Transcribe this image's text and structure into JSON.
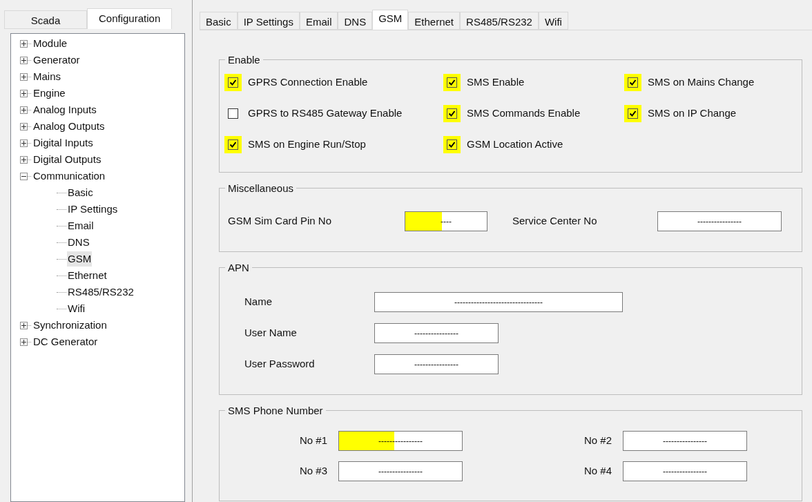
{
  "left_tabs": [
    {
      "label": "Scada",
      "selected": false
    },
    {
      "label": "Configuration",
      "selected": true
    }
  ],
  "tree": [
    {
      "label": "Module",
      "expanded": false,
      "selected": false
    },
    {
      "label": "Generator",
      "expanded": false,
      "selected": false
    },
    {
      "label": "Mains",
      "expanded": false,
      "selected": false
    },
    {
      "label": "Engine",
      "expanded": false,
      "selected": false
    },
    {
      "label": "Analog Inputs",
      "expanded": false,
      "selected": false
    },
    {
      "label": "Analog Outputs",
      "expanded": false,
      "selected": false
    },
    {
      "label": "Digital Inputs",
      "expanded": false,
      "selected": false
    },
    {
      "label": "Digital Outputs",
      "expanded": false,
      "selected": false
    },
    {
      "label": "Communication",
      "expanded": true,
      "selected": false,
      "children": [
        {
          "label": "Basic",
          "selected": false
        },
        {
          "label": "IP Settings",
          "selected": false
        },
        {
          "label": "Email",
          "selected": false
        },
        {
          "label": "DNS",
          "selected": false
        },
        {
          "label": "GSM",
          "selected": true
        },
        {
          "label": "Ethernet",
          "selected": false
        },
        {
          "label": "RS485/RS232",
          "selected": false
        },
        {
          "label": "Wifi",
          "selected": false
        }
      ]
    },
    {
      "label": "Synchronization",
      "expanded": false,
      "selected": false
    },
    {
      "label": "DC Generator",
      "expanded": false,
      "selected": false
    }
  ],
  "tabs": [
    {
      "label": "Basic",
      "selected": false
    },
    {
      "label": "IP Settings",
      "selected": false
    },
    {
      "label": "Email",
      "selected": false
    },
    {
      "label": "DNS",
      "selected": false
    },
    {
      "label": "GSM",
      "selected": true
    },
    {
      "label": "Ethernet",
      "selected": false
    },
    {
      "label": "RS485/RS232",
      "selected": false
    },
    {
      "label": "Wifi",
      "selected": false
    }
  ],
  "enable": {
    "title": "Enable",
    "options": [
      {
        "label": "GPRS Connection Enable",
        "checked": true,
        "highlighted": true
      },
      {
        "label": "SMS Enable",
        "checked": true,
        "highlighted": true
      },
      {
        "label": "SMS on Mains Change",
        "checked": true,
        "highlighted": true
      },
      {
        "label": "GPRS to RS485 Gateway Enable",
        "checked": false,
        "highlighted": false
      },
      {
        "label": "SMS Commands Enable",
        "checked": true,
        "highlighted": true
      },
      {
        "label": "SMS on IP Change",
        "checked": true,
        "highlighted": true
      },
      {
        "label": "SMS on Engine Run/Stop",
        "checked": true,
        "highlighted": true
      },
      {
        "label": "GSM Location Active",
        "checked": true,
        "highlighted": true
      }
    ]
  },
  "miscellaneous": {
    "title": "Miscellaneous",
    "fields": [
      {
        "label": "GSM Sim Card Pin No",
        "value": "----",
        "highlighted": true
      },
      {
        "label": "Service Center No",
        "value": "----------------",
        "highlighted": false
      }
    ]
  },
  "apn": {
    "title": "APN",
    "fields": [
      {
        "label": "Name",
        "value": "--------------------------------",
        "highlighted": false
      },
      {
        "label": "User Name",
        "value": "----------------",
        "highlighted": false
      },
      {
        "label": "User Password",
        "value": "----------------",
        "highlighted": false
      }
    ]
  },
  "sms_phone_number": {
    "title": "SMS Phone Number",
    "fields": [
      {
        "label": "No #1",
        "value": "----------------",
        "highlighted": true
      },
      {
        "label": "No #2",
        "value": "----------------",
        "highlighted": false
      },
      {
        "label": "No #3",
        "value": "----------------",
        "highlighted": false
      },
      {
        "label": "No #4",
        "value": "----------------",
        "highlighted": false
      }
    ]
  }
}
